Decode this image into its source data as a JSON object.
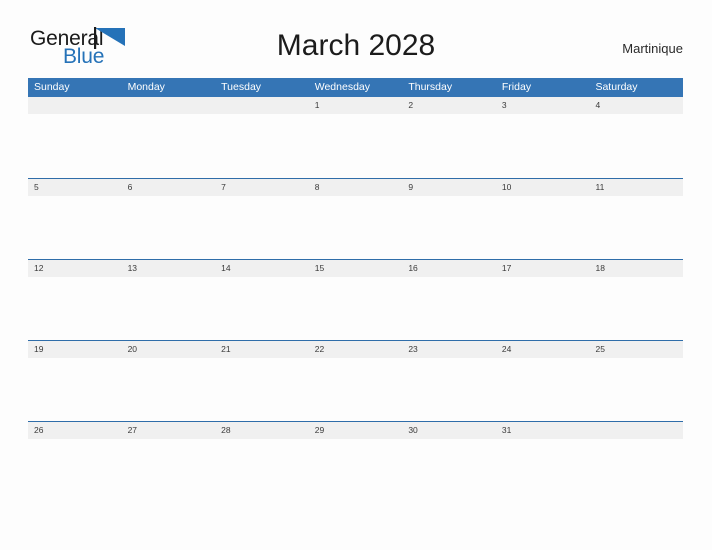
{
  "brand": {
    "name_part1": "General",
    "name_part2": "Blue",
    "flag_color": "#2572b8"
  },
  "header": {
    "title": "March 2028",
    "location": "Martinique"
  },
  "colors": {
    "header_blue": "#3575b5",
    "row_border_blue": "#2f6da9",
    "day_band_gray": "#f0f0f0",
    "page_background": "#fdfdfd"
  },
  "calendar": {
    "month": "March",
    "year": "2028",
    "weekday_labels": [
      "Sunday",
      "Monday",
      "Tuesday",
      "Wednesday",
      "Thursday",
      "Friday",
      "Saturday"
    ],
    "weeks": [
      [
        "",
        "",
        "",
        "1",
        "2",
        "3",
        "4"
      ],
      [
        "5",
        "6",
        "7",
        "8",
        "9",
        "10",
        "11"
      ],
      [
        "12",
        "13",
        "14",
        "15",
        "16",
        "17",
        "18"
      ],
      [
        "19",
        "20",
        "21",
        "22",
        "23",
        "24",
        "25"
      ],
      [
        "26",
        "27",
        "28",
        "29",
        "30",
        "31",
        ""
      ]
    ]
  }
}
